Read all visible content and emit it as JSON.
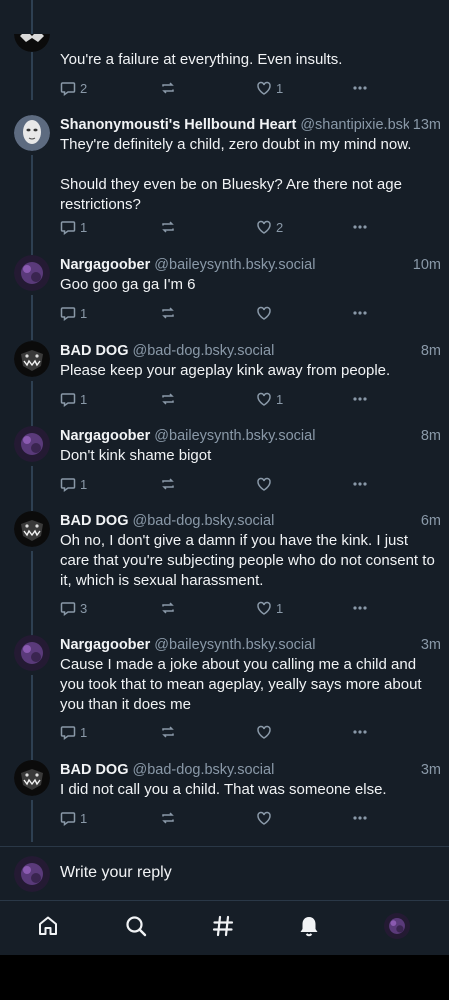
{
  "thread": [
    {
      "name": "",
      "handle": "",
      "time": "",
      "text": "You're a failure at everything. Even insults.",
      "replies": "2",
      "reposts": "",
      "likes": "1",
      "avatar": "bad-dog-avatar"
    },
    {
      "name": "Shanonymousti's Hellbound Heart",
      "handle": "@shantipixie.bsk...",
      "time": "13m",
      "text": "They're definitely a child, zero doubt in my mind now.\n\nShould they even be on Bluesky? Are there not age restrictions?",
      "replies": "1",
      "reposts": "",
      "likes": "2",
      "avatar": "mask-avatar"
    },
    {
      "name": "Nargagoober",
      "handle": "@baileysynth.bsky.social",
      "time": "10m",
      "text": "Goo goo ga ga I'm 6",
      "replies": "1",
      "reposts": "",
      "likes": "",
      "avatar": "purple-avatar"
    },
    {
      "name": "BAD DOG",
      "handle": "@bad-dog.bsky.social",
      "time": "8m",
      "text": "Please keep your ageplay kink away from people.",
      "replies": "1",
      "reposts": "",
      "likes": "1",
      "avatar": "bad-dog-avatar"
    },
    {
      "name": "Nargagoober",
      "handle": "@baileysynth.bsky.social",
      "time": "8m",
      "text": "Don't kink shame bigot",
      "replies": "1",
      "reposts": "",
      "likes": "",
      "avatar": "purple-avatar"
    },
    {
      "name": "BAD DOG",
      "handle": "@bad-dog.bsky.social",
      "time": "6m",
      "text": "Oh no, I don't give a damn if you have the kink. I just care that you're subjecting people who do not consent to it, which is sexual harassment.",
      "replies": "3",
      "reposts": "",
      "likes": "1",
      "avatar": "bad-dog-avatar"
    },
    {
      "name": "Nargagoober",
      "handle": "@baileysynth.bsky.social",
      "time": "3m",
      "text": "Cause I made a joke about you calling me a child and you took that to mean ageplay, yeally says more about you than it does me",
      "replies": "1",
      "reposts": "",
      "likes": "",
      "avatar": "purple-avatar"
    },
    {
      "name": "BAD DOG",
      "handle": "@bad-dog.bsky.social",
      "time": "3m",
      "text": "I did not call you a child. That was someone else.",
      "replies": "1",
      "reposts": "",
      "likes": "",
      "avatar": "bad-dog-avatar"
    }
  ],
  "reply_bar": {
    "placeholder": "Write your reply"
  },
  "nav": {
    "items": [
      "home-icon",
      "search-icon",
      "feeds-hash-icon",
      "notifications-bell-icon",
      "profile-avatar"
    ]
  },
  "colors": {
    "background": "#161e27",
    "muted": "#8a99a8",
    "divider": "#2a3847",
    "thread_line": "#2e4052"
  }
}
